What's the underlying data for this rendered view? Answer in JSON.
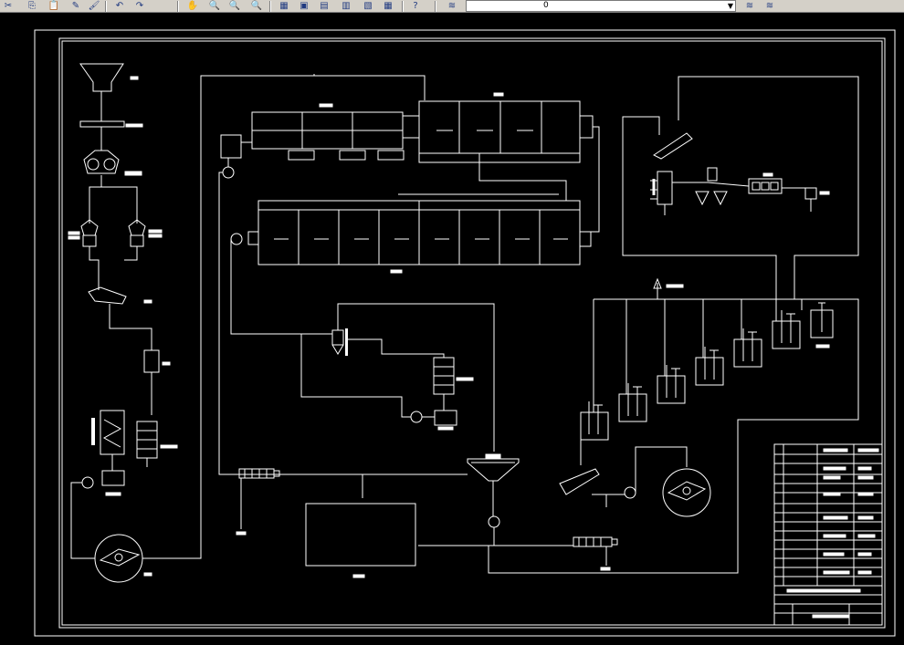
{
  "toolbar": {
    "buttons": [
      {
        "name": "cut-icon",
        "glyph": "✂"
      },
      {
        "name": "copy-icon",
        "glyph": "⎘"
      },
      {
        "name": "paste-icon",
        "glyph": "📋"
      },
      {
        "name": "match-properties-icon",
        "glyph": "✎"
      },
      {
        "name": "brush-icon",
        "glyph": "🖌"
      },
      {
        "name": "undo-icon",
        "glyph": "↶"
      },
      {
        "name": "redo-icon",
        "glyph": "↷"
      },
      {
        "name": "pan-icon",
        "glyph": "✋"
      },
      {
        "name": "zoom-realtime-icon",
        "glyph": "🔍"
      },
      {
        "name": "zoom-window-icon",
        "glyph": "🔍"
      },
      {
        "name": "zoom-previous-icon",
        "glyph": "🔍"
      },
      {
        "name": "properties-icon",
        "glyph": "▦"
      },
      {
        "name": "design-center-icon",
        "glyph": "▣"
      },
      {
        "name": "tool-palettes-icon",
        "glyph": "▤"
      },
      {
        "name": "sheet-set-icon",
        "glyph": "▥"
      },
      {
        "name": "markup-icon",
        "glyph": "▧"
      },
      {
        "name": "calculator-icon",
        "glyph": "▦"
      },
      {
        "name": "help-icon",
        "glyph": "?"
      },
      {
        "name": "layer-manager-icon",
        "glyph": "≋"
      },
      {
        "name": "layer-previous-icon",
        "glyph": "≋"
      },
      {
        "name": "layer-states-icon",
        "glyph": "≋"
      }
    ],
    "layer_value": "0"
  },
  "colors": {
    "background": "#000000",
    "lines": "#ffffff",
    "toolbar": "#d4d0c8"
  }
}
